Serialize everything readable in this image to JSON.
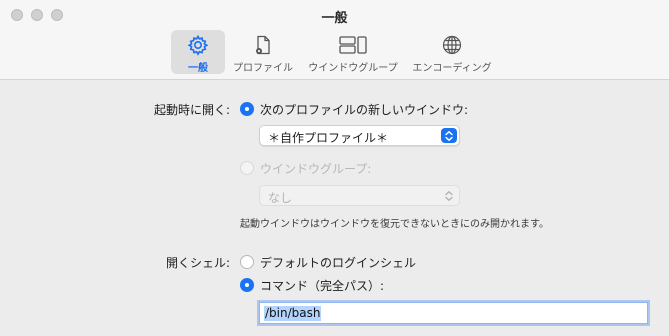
{
  "window": {
    "title": "一般"
  },
  "toolbar": {
    "tabs": [
      {
        "label": "一般",
        "icon": "gear-icon",
        "selected": true
      },
      {
        "label": "プロファイル",
        "icon": "profile-doc-icon",
        "selected": false
      },
      {
        "label": "ウインドウグループ",
        "icon": "window-group-icon",
        "selected": false
      },
      {
        "label": "エンコーディング",
        "icon": "globe-icon",
        "selected": false
      }
    ]
  },
  "startup": {
    "label": "起動時に開く:",
    "option_profile": "次のプロファイルの新しいウインドウ:",
    "profile_value": "＊自作プロファイル＊",
    "option_group": "ウインドウグループ:",
    "group_value": "なし",
    "note": "起動ウインドウはウインドウを復元できないときにのみ開かれます。"
  },
  "shell": {
    "label": "開くシェル:",
    "option_default": "デフォルトのログインシェル",
    "option_command": "コマンド（完全パス）:",
    "command_value": "/bin/bash"
  },
  "colors": {
    "accent": "#1a73f2"
  }
}
